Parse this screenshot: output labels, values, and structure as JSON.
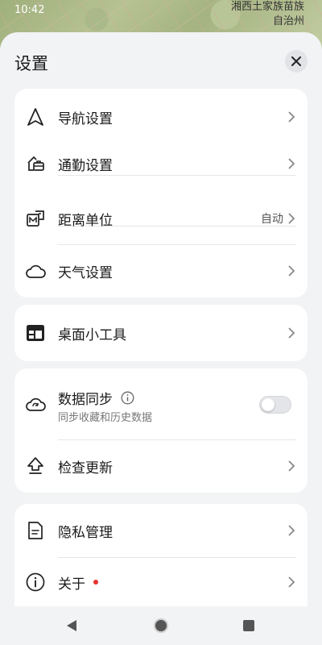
{
  "status_bar": {
    "time": "10:42"
  },
  "map": {
    "label_line1": "湘西土家族苗族",
    "label_line2": "自治州"
  },
  "sheet": {
    "title": "设置",
    "close_icon": "close-icon"
  },
  "groups": {
    "main": {
      "navigation": {
        "label": "导航设置",
        "icon": "navigation-arrow-icon"
      },
      "commute": {
        "label": "通勤设置",
        "icon": "briefcase-home-icon"
      },
      "distance_unit": {
        "label": "距离单位",
        "value": "自动",
        "icon": "unit-km-mi-icon"
      },
      "weather": {
        "label": "天气设置",
        "icon": "cloud-icon"
      }
    },
    "widget": {
      "label": "桌面小工具",
      "icon": "widget-icon"
    },
    "sync": {
      "data_sync": {
        "label": "数据同步",
        "sub": "同步收藏和历史数据",
        "enabled": false,
        "icon": "cloud-sync-icon",
        "info_icon": "info-icon"
      },
      "update": {
        "label": "检查更新",
        "icon": "upload-arrow-icon"
      }
    },
    "about_group": {
      "privacy": {
        "label": "隐私管理",
        "icon": "document-icon"
      },
      "about": {
        "label": "关于",
        "icon": "info-circle-icon",
        "has_badge": true
      }
    }
  },
  "colors": {
    "badge": "#e8322e",
    "background": "#f2f3f5",
    "card": "#ffffff"
  },
  "navbar": {
    "back": "back-triangle-icon",
    "home": "home-circle-icon",
    "recent": "recent-square-icon"
  }
}
